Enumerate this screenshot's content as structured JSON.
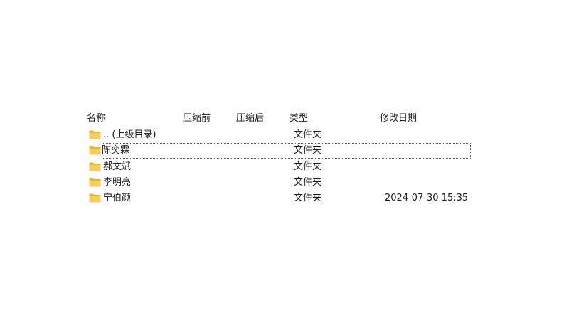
{
  "columns": {
    "name": "名称",
    "compressed_before": "压缩前",
    "compressed_after": "压缩后",
    "type": "类型",
    "modified": "修改日期"
  },
  "rows": [
    {
      "name": ".. (上级目录)",
      "type": "文件夹",
      "modified": "",
      "icon": "folder-icon"
    },
    {
      "name": "陈奕霖",
      "type": "文件夹",
      "modified": "",
      "icon": "folder-icon",
      "selected": true
    },
    {
      "name": "郝文斌",
      "type": "文件夹",
      "modified": "",
      "icon": "folder-icon"
    },
    {
      "name": "李明亮",
      "type": "文件夹",
      "modified": "",
      "icon": "folder-icon"
    },
    {
      "name": "宁伯颜",
      "type": "文件夹",
      "modified": "2024-07-30 15:35",
      "icon": "folder-icon"
    }
  ],
  "colors": {
    "folder_back": "#e8b33a",
    "folder_front": "#f6cf5a",
    "selection_border": "#555555"
  }
}
